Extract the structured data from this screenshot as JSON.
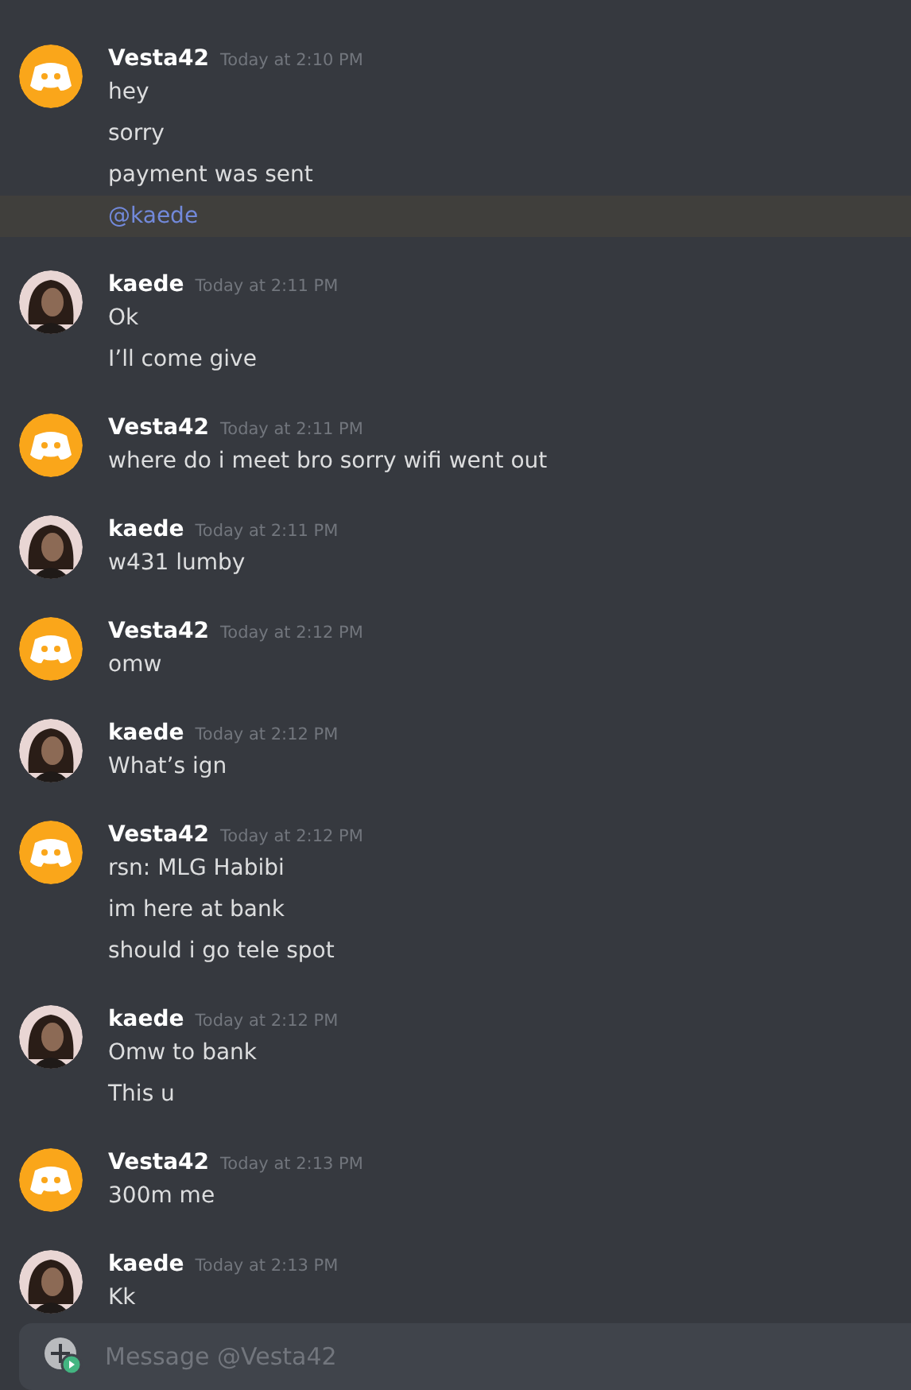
{
  "messages": [
    {
      "author": "Vesta42",
      "kind": "default",
      "time": "Today at 2:10 PM",
      "lines": [
        {
          "kind": "text",
          "text": "hey"
        },
        {
          "kind": "text",
          "text": "sorry"
        },
        {
          "kind": "text",
          "text": "payment was sent"
        },
        {
          "kind": "mention",
          "text": "@kaede"
        }
      ]
    },
    {
      "author": "kaede",
      "kind": "photo",
      "time": "Today at 2:11 PM",
      "lines": [
        {
          "kind": "text",
          "text": "Ok"
        },
        {
          "kind": "text",
          "text": "I’ll come give"
        }
      ]
    },
    {
      "author": "Vesta42",
      "kind": "default",
      "time": "Today at 2:11 PM",
      "lines": [
        {
          "kind": "text",
          "text": "where do i meet bro sorry wifi went out"
        }
      ]
    },
    {
      "author": "kaede",
      "kind": "photo",
      "time": "Today at 2:11 PM",
      "lines": [
        {
          "kind": "text",
          "text": "w431 lumby"
        }
      ]
    },
    {
      "author": "Vesta42",
      "kind": "default",
      "time": "Today at 2:12 PM",
      "lines": [
        {
          "kind": "text",
          "text": "omw"
        }
      ]
    },
    {
      "author": "kaede",
      "kind": "photo",
      "time": "Today at 2:12 PM",
      "lines": [
        {
          "kind": "text",
          "text": "What’s ign"
        }
      ]
    },
    {
      "author": "Vesta42",
      "kind": "default",
      "time": "Today at 2:12 PM",
      "lines": [
        {
          "kind": "text",
          "text": "rsn: MLG Habibi"
        },
        {
          "kind": "text",
          "text": "im here at bank"
        },
        {
          "kind": "text",
          "text": "should i go tele spot"
        }
      ]
    },
    {
      "author": "kaede",
      "kind": "photo",
      "time": "Today at 2:12 PM",
      "lines": [
        {
          "kind": "text",
          "text": "Omw to bank"
        },
        {
          "kind": "text",
          "text": "This u"
        }
      ]
    },
    {
      "author": "Vesta42",
      "kind": "default",
      "time": "Today at 2:13 PM",
      "lines": [
        {
          "kind": "text",
          "text": "300m me"
        }
      ]
    },
    {
      "author": "kaede",
      "kind": "photo",
      "time": "Today at 2:13 PM",
      "lines": [
        {
          "kind": "text",
          "text": "Kk"
        }
      ]
    }
  ],
  "composer": {
    "placeholder": "Message @Vesta42"
  }
}
